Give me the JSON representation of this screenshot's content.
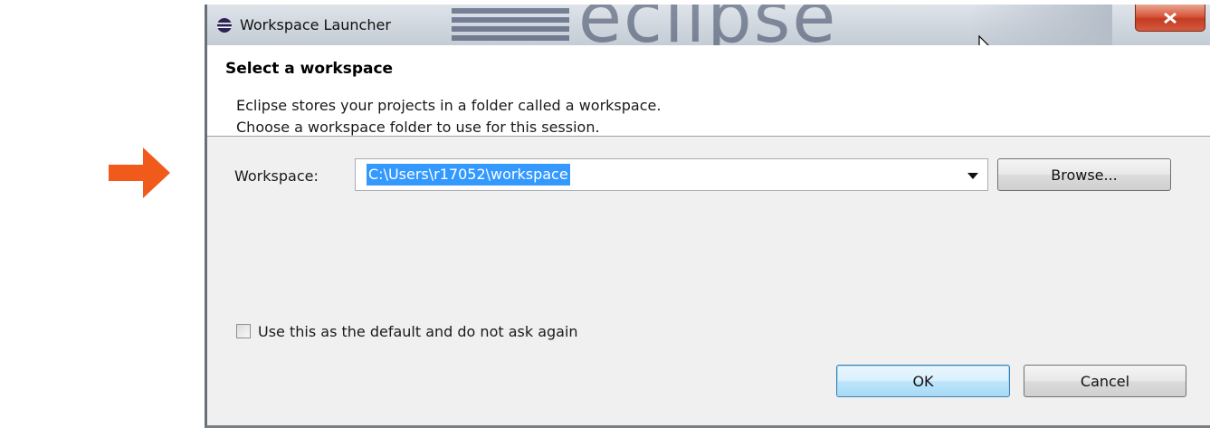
{
  "window": {
    "title": "Workspace Launcher",
    "watermark": "eclipse"
  },
  "header": {
    "title": "Select a workspace",
    "line1": "Eclipse stores your projects in a folder called a workspace.",
    "line2": "Choose a workspace folder to use for this session."
  },
  "workspace": {
    "label": "Workspace:",
    "value": "C:\\Users\\r17052\\workspace",
    "browse_label": "Browse..."
  },
  "default_checkbox": {
    "label": "Use this as the default and do not ask again",
    "checked": false
  },
  "buttons": {
    "ok_label": "OK",
    "cancel_label": "Cancel"
  },
  "colors": {
    "pointer_arrow": "#f05a1a",
    "selection": "#3399ff",
    "close_button": "#d9573c"
  },
  "icons": {
    "app": "eclipse-icon",
    "close": "close-icon",
    "dropdown": "chevron-down-icon",
    "pointer": "arrow-right-icon",
    "cursor": "mouse-cursor-icon"
  }
}
